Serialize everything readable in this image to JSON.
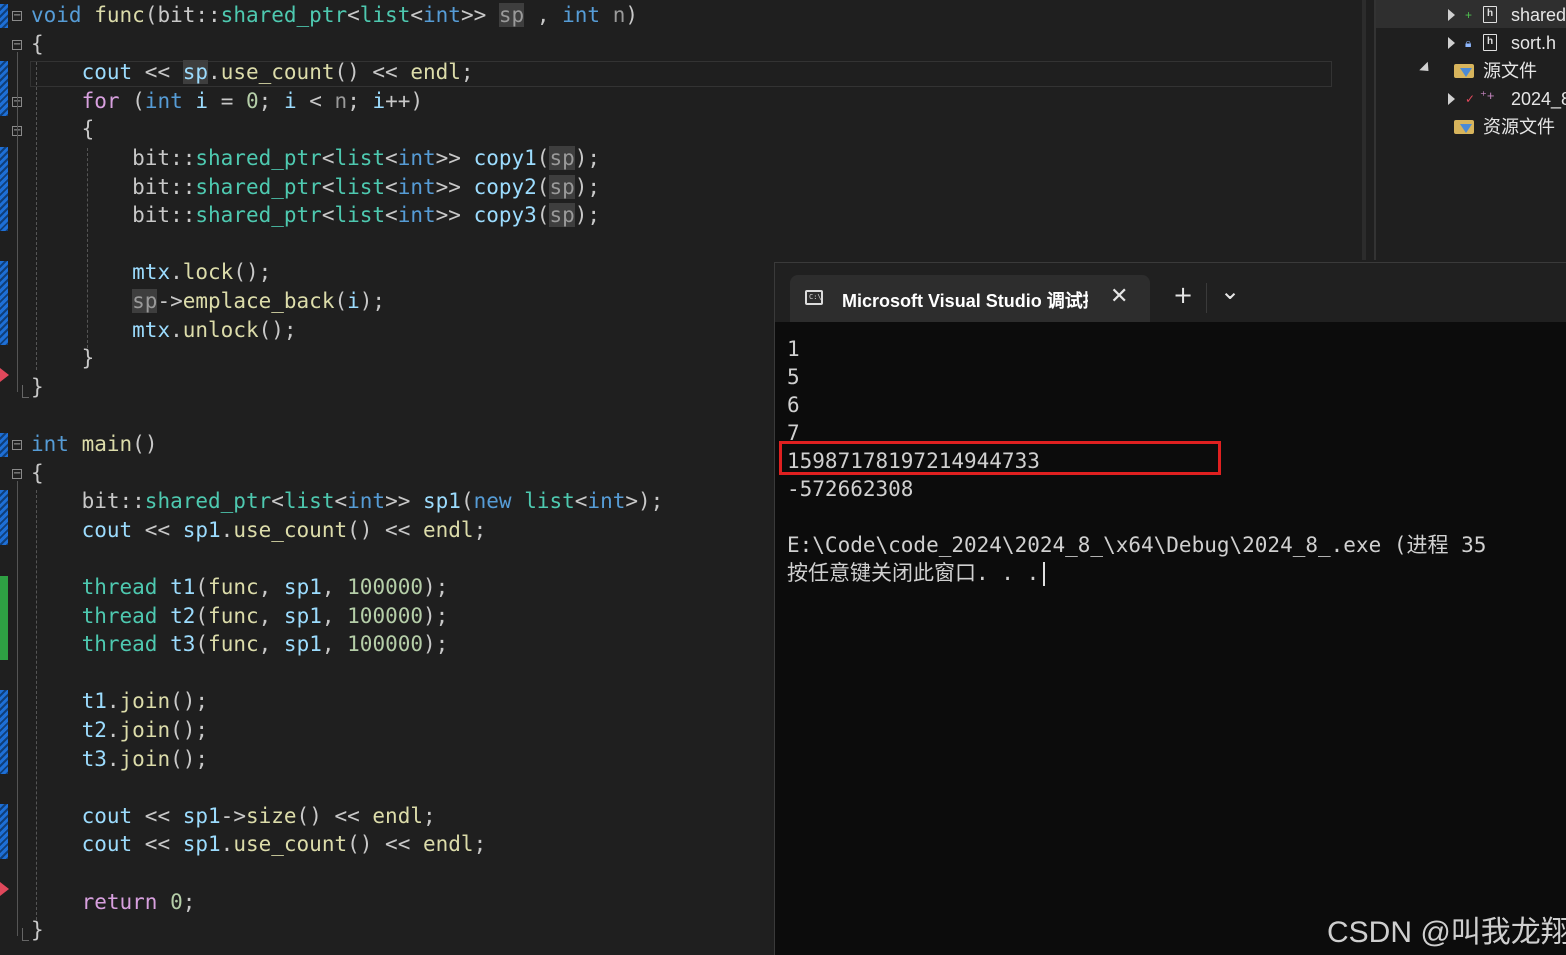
{
  "editor": {
    "lines": [
      {
        "parts": [
          [
            "kw",
            "void"
          ],
          [
            "nf",
            " "
          ],
          [
            "fn",
            "func"
          ],
          [
            "nf",
            "(bit::"
          ],
          [
            "ty",
            "shared_ptr"
          ],
          [
            "nf",
            "<"
          ],
          [
            "ty",
            "list"
          ],
          [
            "nf",
            "<"
          ],
          [
            "kw",
            "int"
          ],
          [
            "nf",
            ">> "
          ],
          [
            "pm hl",
            "sp"
          ],
          [
            "nf",
            " , "
          ],
          [
            "kw",
            "int"
          ],
          [
            "nf",
            " "
          ],
          [
            "pm",
            "n"
          ],
          [
            "nf",
            ")"
          ]
        ]
      },
      {
        "parts": [
          [
            "nf",
            "{"
          ]
        ]
      },
      {
        "parts": [
          [
            "nf",
            "    "
          ],
          [
            "var",
            "cout"
          ],
          [
            "nf",
            " << "
          ],
          [
            "var hl",
            "sp"
          ],
          [
            "nf",
            "."
          ],
          [
            "fn",
            "use_count"
          ],
          [
            "nf",
            "() << "
          ],
          [
            "fn",
            "endl"
          ],
          [
            "nf",
            ";"
          ]
        ]
      },
      {
        "parts": [
          [
            "nf",
            "    "
          ],
          [
            "kwc",
            "for"
          ],
          [
            "nf",
            " ("
          ],
          [
            "kw",
            "int"
          ],
          [
            "nf",
            " "
          ],
          [
            "var",
            "i"
          ],
          [
            "nf",
            " = "
          ],
          [
            "num",
            "0"
          ],
          [
            "nf",
            "; "
          ],
          [
            "var",
            "i"
          ],
          [
            "nf",
            " < "
          ],
          [
            "pm",
            "n"
          ],
          [
            "nf",
            "; "
          ],
          [
            "var",
            "i"
          ],
          [
            "nf",
            "++)"
          ]
        ]
      },
      {
        "parts": [
          [
            "nf",
            "    {"
          ]
        ]
      },
      {
        "parts": [
          [
            "nf",
            "        bit::"
          ],
          [
            "ty",
            "shared_ptr"
          ],
          [
            "nf",
            "<"
          ],
          [
            "ty",
            "list"
          ],
          [
            "nf",
            "<"
          ],
          [
            "kw",
            "int"
          ],
          [
            "nf",
            ">> "
          ],
          [
            "var",
            "copy1"
          ],
          [
            "nf",
            "("
          ],
          [
            "pm hl",
            "sp"
          ],
          [
            "nf",
            ");"
          ]
        ]
      },
      {
        "parts": [
          [
            "nf",
            "        bit::"
          ],
          [
            "ty",
            "shared_ptr"
          ],
          [
            "nf",
            "<"
          ],
          [
            "ty",
            "list"
          ],
          [
            "nf",
            "<"
          ],
          [
            "kw",
            "int"
          ],
          [
            "nf",
            ">> "
          ],
          [
            "var",
            "copy2"
          ],
          [
            "nf",
            "("
          ],
          [
            "pm hl",
            "sp"
          ],
          [
            "nf",
            ");"
          ]
        ]
      },
      {
        "parts": [
          [
            "nf",
            "        bit::"
          ],
          [
            "ty",
            "shared_ptr"
          ],
          [
            "nf",
            "<"
          ],
          [
            "ty",
            "list"
          ],
          [
            "nf",
            "<"
          ],
          [
            "kw",
            "int"
          ],
          [
            "nf",
            ">> "
          ],
          [
            "var",
            "copy3"
          ],
          [
            "nf",
            "("
          ],
          [
            "pm hl",
            "sp"
          ],
          [
            "nf",
            ");"
          ]
        ]
      },
      {
        "parts": []
      },
      {
        "parts": [
          [
            "nf",
            "        "
          ],
          [
            "var",
            "mtx"
          ],
          [
            "nf",
            "."
          ],
          [
            "fn",
            "lock"
          ],
          [
            "nf",
            "();"
          ]
        ]
      },
      {
        "parts": [
          [
            "nf",
            "        "
          ],
          [
            "pm hl",
            "sp"
          ],
          [
            "nf",
            "->"
          ],
          [
            "fn",
            "emplace_back"
          ],
          [
            "nf",
            "("
          ],
          [
            "var",
            "i"
          ],
          [
            "nf",
            ");"
          ]
        ]
      },
      {
        "parts": [
          [
            "nf",
            "        "
          ],
          [
            "var",
            "mtx"
          ],
          [
            "nf",
            "."
          ],
          [
            "fn",
            "unlock"
          ],
          [
            "nf",
            "();"
          ]
        ]
      },
      {
        "parts": [
          [
            "nf",
            "    }"
          ]
        ]
      },
      {
        "parts": [
          [
            "nf",
            "}"
          ]
        ]
      },
      {
        "parts": []
      },
      {
        "parts": [
          [
            "kw",
            "int"
          ],
          [
            "nf",
            " "
          ],
          [
            "fn",
            "main"
          ],
          [
            "nf",
            "()"
          ]
        ]
      },
      {
        "parts": [
          [
            "nf",
            "{"
          ]
        ]
      },
      {
        "parts": [
          [
            "nf",
            "    bit::"
          ],
          [
            "ty",
            "shared_ptr"
          ],
          [
            "nf",
            "<"
          ],
          [
            "ty",
            "list"
          ],
          [
            "nf",
            "<"
          ],
          [
            "kw",
            "int"
          ],
          [
            "nf",
            ">> "
          ],
          [
            "var",
            "sp1"
          ],
          [
            "nf",
            "("
          ],
          [
            "kw",
            "new"
          ],
          [
            "nf",
            " "
          ],
          [
            "ty",
            "list"
          ],
          [
            "nf",
            "<"
          ],
          [
            "kw",
            "int"
          ],
          [
            "nf",
            ">);"
          ]
        ]
      },
      {
        "parts": [
          [
            "nf",
            "    "
          ],
          [
            "var",
            "cout"
          ],
          [
            "nf",
            " << "
          ],
          [
            "var",
            "sp1"
          ],
          [
            "nf",
            "."
          ],
          [
            "fn",
            "use_count"
          ],
          [
            "nf",
            "() << "
          ],
          [
            "fn",
            "endl"
          ],
          [
            "nf",
            ";"
          ]
        ]
      },
      {
        "parts": []
      },
      {
        "parts": [
          [
            "nf",
            "    "
          ],
          [
            "ty",
            "thread"
          ],
          [
            "nf",
            " "
          ],
          [
            "var",
            "t1"
          ],
          [
            "nf",
            "("
          ],
          [
            "fn",
            "func"
          ],
          [
            "nf",
            ", "
          ],
          [
            "var",
            "sp1"
          ],
          [
            "nf",
            ", "
          ],
          [
            "num",
            "100000"
          ],
          [
            "nf",
            ");"
          ]
        ]
      },
      {
        "parts": [
          [
            "nf",
            "    "
          ],
          [
            "ty",
            "thread"
          ],
          [
            "nf",
            " "
          ],
          [
            "var",
            "t2"
          ],
          [
            "nf",
            "("
          ],
          [
            "fn",
            "func"
          ],
          [
            "nf",
            ", "
          ],
          [
            "var",
            "sp1"
          ],
          [
            "nf",
            ", "
          ],
          [
            "num",
            "100000"
          ],
          [
            "nf",
            ");"
          ]
        ]
      },
      {
        "parts": [
          [
            "nf",
            "    "
          ],
          [
            "ty",
            "thread"
          ],
          [
            "nf",
            " "
          ],
          [
            "var",
            "t3"
          ],
          [
            "nf",
            "("
          ],
          [
            "fn",
            "func"
          ],
          [
            "nf",
            ", "
          ],
          [
            "var",
            "sp1"
          ],
          [
            "nf",
            ", "
          ],
          [
            "num",
            "100000"
          ],
          [
            "nf",
            ");"
          ]
        ]
      },
      {
        "parts": []
      },
      {
        "parts": [
          [
            "nf",
            "    "
          ],
          [
            "var",
            "t1"
          ],
          [
            "nf",
            "."
          ],
          [
            "fn",
            "join"
          ],
          [
            "nf",
            "();"
          ]
        ]
      },
      {
        "parts": [
          [
            "nf",
            "    "
          ],
          [
            "var",
            "t2"
          ],
          [
            "nf",
            "."
          ],
          [
            "fn",
            "join"
          ],
          [
            "nf",
            "();"
          ]
        ]
      },
      {
        "parts": [
          [
            "nf",
            "    "
          ],
          [
            "var",
            "t3"
          ],
          [
            "nf",
            "."
          ],
          [
            "fn",
            "join"
          ],
          [
            "nf",
            "();"
          ]
        ]
      },
      {
        "parts": []
      },
      {
        "parts": [
          [
            "nf",
            "    "
          ],
          [
            "var",
            "cout"
          ],
          [
            "nf",
            " << "
          ],
          [
            "var",
            "sp1"
          ],
          [
            "nf",
            "->"
          ],
          [
            "fn",
            "size"
          ],
          [
            "nf",
            "() << "
          ],
          [
            "fn",
            "endl"
          ],
          [
            "nf",
            ";"
          ]
        ]
      },
      {
        "parts": [
          [
            "nf",
            "    "
          ],
          [
            "var",
            "cout"
          ],
          [
            "nf",
            " << "
          ],
          [
            "var",
            "sp1"
          ],
          [
            "nf",
            "."
          ],
          [
            "fn",
            "use_count"
          ],
          [
            "nf",
            "() << "
          ],
          [
            "fn",
            "endl"
          ],
          [
            "nf",
            ";"
          ]
        ]
      },
      {
        "parts": []
      },
      {
        "parts": [
          [
            "nf",
            "    "
          ],
          [
            "kwc",
            "return"
          ],
          [
            "nf",
            " "
          ],
          [
            "num",
            "0"
          ],
          [
            "nf",
            ";"
          ]
        ]
      },
      {
        "parts": [
          [
            "nf",
            "}"
          ]
        ]
      }
    ]
  },
  "explorer": {
    "items": [
      {
        "label": "shared",
        "icon": "header-file-icon",
        "badge": "+"
      },
      {
        "label": "sort.h",
        "icon": "header-file-icon",
        "badge": "lock"
      },
      {
        "label": "源文件",
        "icon": "folder-icon"
      },
      {
        "label": "2024_8",
        "icon": "source-file-icon",
        "badge": "✓+"
      },
      {
        "label": "资源文件",
        "icon": "folder-icon"
      }
    ]
  },
  "console": {
    "tab_title": "Microsoft Visual Studio 调试控制台",
    "tab_icon_text": "C:\\",
    "close_glyph": "✕",
    "new_tab_glyph": "+",
    "dropdown_glyph": "⌄",
    "output_lines": [
      "1",
      "5",
      "6",
      "7",
      "15987178197214944733",
      "-572662308",
      "",
      "E:\\Code\\code_2024\\2024_8_\\x64\\Debug\\2024_8_.exe (进程 35",
      "按任意键关闭此窗口. . ."
    ],
    "highlighted_line_index": 4
  },
  "watermark": "CSDN @叫我龙翔",
  "colors": {
    "keyword": "#569cd6",
    "control": "#d8a0df",
    "type": "#4ec9b0",
    "function": "#dcdcaa",
    "variable": "#9cdcfe",
    "number": "#b5cea8",
    "highlight_box": "#e02020",
    "breakpoint": "#e0485b"
  }
}
